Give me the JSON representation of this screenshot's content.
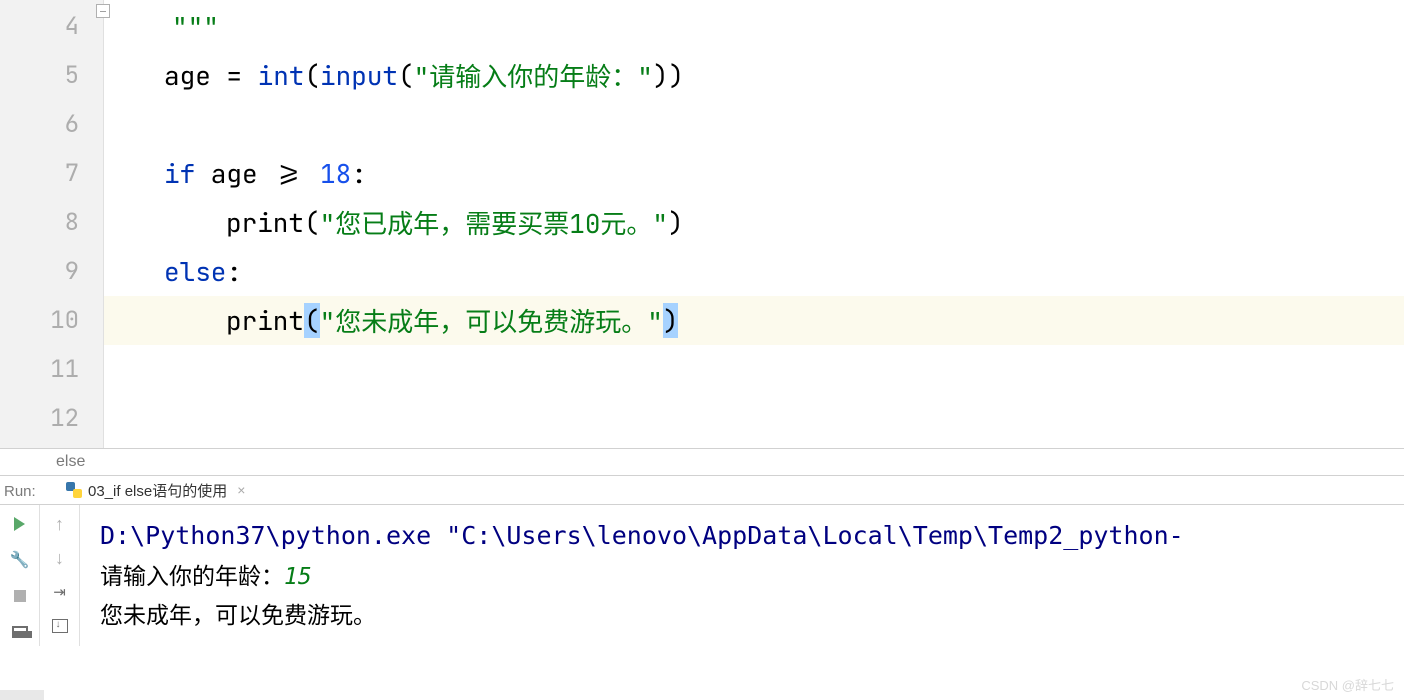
{
  "gutter": {
    "lines": [
      "4",
      "5",
      "6",
      "7",
      "8",
      "9",
      "10",
      "11",
      "12"
    ]
  },
  "code": {
    "line4_text": "\"\"\"",
    "line5": {
      "var": "age = ",
      "int": "int",
      "p1": "(",
      "input": "input",
      "p2": "(",
      "str": "\"请输入你的年龄：\"",
      "p3": "))"
    },
    "line7": {
      "if": "if",
      "cond": " age >= ",
      "num": "18",
      "colon": ":"
    },
    "line8": {
      "print": "print",
      "p1": "(",
      "str": "\"您已成年，需要买票10元。\"",
      "p2": ")"
    },
    "line9": {
      "else": "else",
      "colon": ":"
    },
    "line10": {
      "print": "print",
      "p1": "(",
      "str": "\"您未成年，可以免费游玩。\"",
      "p2": ")"
    }
  },
  "breadcrumb": "else",
  "run": {
    "label": "Run:",
    "tab_name": "03_if else语句的使用",
    "tab_close": "×"
  },
  "console": {
    "cmd": "D:\\Python37\\python.exe \"C:\\Users\\lenovo\\AppData\\Local\\Temp\\Temp2_python-",
    "prompt": "请输入你的年龄：",
    "input": "15",
    "output": "您未成年，可以免费游玩。"
  },
  "watermark": "CSDN @辞七七"
}
